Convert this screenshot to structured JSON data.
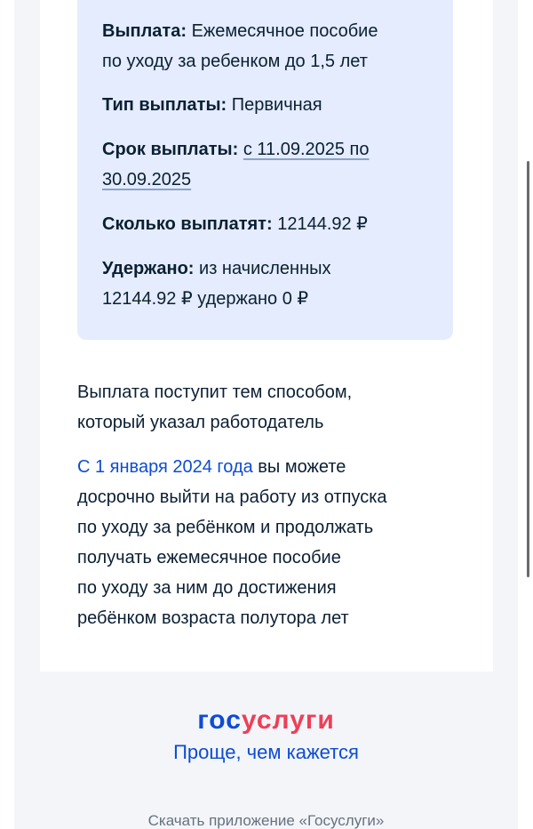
{
  "details": {
    "payment_label": "Выплата:",
    "payment_value_line1": "Ежемесячное пособие",
    "payment_value_line2": "по уходу за ребенком до 1,5 лет",
    "type_label": "Тип выплаты:",
    "type_value": "Первичная",
    "term_label": "Срок выплаты:",
    "term_value_line1": "с 11.09.2025 по",
    "term_value_line2": "30.09.2025",
    "amount_label": "Сколько выплатят:",
    "amount_value": "12144.92 ₽",
    "withheld_label": "Удержано:",
    "withheld_value_line1": "из начисленных",
    "withheld_value_line2": "12144.92 ₽ удержано 0 ₽"
  },
  "notes": {
    "method_line1": "Выплата поступит тем способом,",
    "method_line2": "который указал работодатель",
    "early_link": "С 1 января 2024 года",
    "early_line1_rest": " вы можете",
    "early_line2": "досрочно выйти на работу из отпуска",
    "early_line3": "по уходу за ребёнком и продолжать",
    "early_line4": "получать ежемесячное пособие",
    "early_line5": "по уходу за ним до достижения",
    "early_line6": "ребёнком возраста полутора лет"
  },
  "footer": {
    "logo_part1": "гос",
    "logo_part2": "услуги",
    "slogan": "Проще, чем кажется",
    "download": "Скачать приложение «Госуслуги»"
  },
  "colors": {
    "card_bg": "#e4ecfd",
    "link": "#0d4cd3",
    "logo_red": "#ee3f58"
  }
}
